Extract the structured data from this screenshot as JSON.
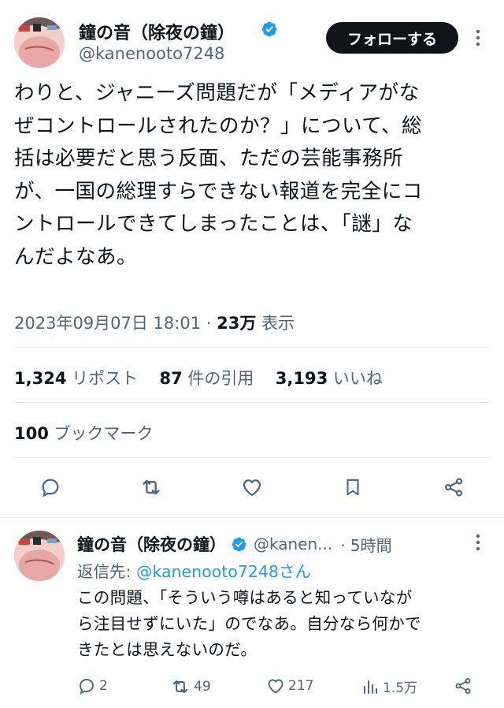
{
  "tweet": {
    "author_name": "鐘の音（除夜の鐘）",
    "author_handle": "@kanenooto7248",
    "follow_label": "フォローする",
    "lines": [
      "わりと、ジャニーズ問題だが「メディアがな",
      "ぜコントロールされたのか？」について、総",
      "括は必要だと思う反面、ただの芸能事務所",
      "が、一国の総理すらできない報道を完全にコ",
      "ントロールできてしまったことは、「謎」な",
      "んだよなあ。"
    ],
    "timestamp": "2023年09月07日 18:01",
    "views_count": "23万",
    "views_label": "表示",
    "reposts_count": "1,324",
    "reposts_label": "リポスト",
    "quotes_count": "87",
    "quotes_label": "件の引用",
    "likes_count": "3,193",
    "likes_label": "いいね",
    "bookmarks_count": "100",
    "bookmarks_label": "ブックマーク"
  },
  "reply": {
    "author_name": "鐘の音（除夜の鐘）",
    "author_handle": "@kanen...",
    "time": "· 5時間",
    "reply_to_prefix": "返信先: ",
    "reply_to_handle": "@kanenooto7248さん",
    "lines": [
      "この問題、「そういう噂はあると知っていなが",
      "ら注目せずにいた」のでなあ。自分なら何かで",
      "きたとは思えないのだ。"
    ],
    "replies": "2",
    "reposts": "49",
    "likes": "217",
    "views": "1.5万"
  },
  "colors": {
    "verified": "#1d9bf0",
    "muted": "#536471",
    "link": "#1d9bf0"
  },
  "icons": [
    "verified-badge-icon",
    "more-icon",
    "reply-icon",
    "repost-icon",
    "like-icon",
    "bookmark-icon",
    "share-icon",
    "views-icon"
  ]
}
